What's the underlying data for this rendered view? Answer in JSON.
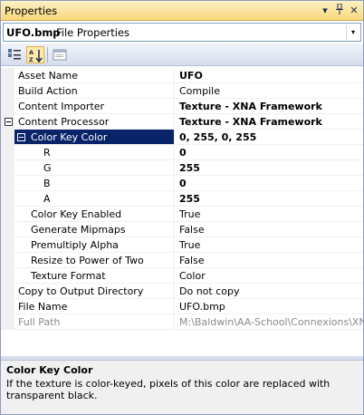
{
  "window": {
    "title": "Properties",
    "dropdown_glyph": "▾",
    "pin_glyph": "ᛘ",
    "close_glyph": "✕"
  },
  "object_selector": {
    "name": "UFO.bmp",
    "type": "File Properties",
    "dropdown_glyph": "▾"
  },
  "toolbar": {
    "buttons": [
      "categorized-icon",
      "alphabetical-icon",
      "property-pages-icon"
    ]
  },
  "grid": {
    "rows": [
      {
        "name": "Asset Name",
        "value": "UFO",
        "bold": true
      },
      {
        "name": "Build Action",
        "value": "Compile",
        "bold": false
      },
      {
        "name": "Content Importer",
        "value": "Texture - XNA Framework",
        "bold": true
      },
      {
        "name": "Content Processor",
        "value": "Texture - XNA Framework",
        "bold": true,
        "expanded": true
      },
      {
        "name": "Color Key Color",
        "value": "0, 255, 0, 255",
        "bold": true,
        "expanded": true,
        "selected": true
      },
      {
        "name": "R",
        "value": "0",
        "bold": true
      },
      {
        "name": "G",
        "value": "255",
        "bold": true
      },
      {
        "name": "B",
        "value": "0",
        "bold": true
      },
      {
        "name": "A",
        "value": "255",
        "bold": true
      },
      {
        "name": "Color Key Enabled",
        "value": "True",
        "bold": false
      },
      {
        "name": "Generate Mipmaps",
        "value": "False",
        "bold": false
      },
      {
        "name": "Premultiply Alpha",
        "value": "True",
        "bold": false
      },
      {
        "name": "Resize to Power of Two",
        "value": "False",
        "bold": false
      },
      {
        "name": "Texture Format",
        "value": "Color",
        "bold": false
      },
      {
        "name": "Copy to Output Directory",
        "value": "Do not copy",
        "bold": false
      },
      {
        "name": "File Name",
        "value": "UFO.bmp",
        "bold": false
      },
      {
        "name": "Full Path",
        "value": "M:\\Baldwin\\AA-School\\Connexions\\XNA Ga",
        "bold": false,
        "readonly": true
      }
    ]
  },
  "description": {
    "title": "Color Key Color",
    "text": "If the texture is color-keyed, pixels of this color are replaced with transparent black."
  },
  "colors": {
    "selection": "#0a246a",
    "titlebar": "#f8d77a",
    "readonly_text": "#8a8a8a"
  }
}
